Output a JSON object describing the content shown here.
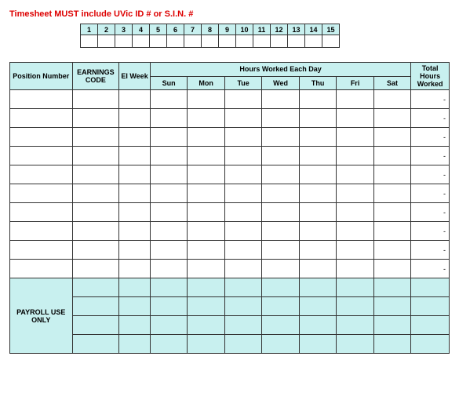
{
  "warning_text": "Timesheet MUST include UVic ID # or S.I.N. #",
  "id_numbers": [
    "1",
    "2",
    "3",
    "4",
    "5",
    "6",
    "7",
    "8",
    "9",
    "10",
    "11",
    "12",
    "13",
    "14",
    "15"
  ],
  "headers": {
    "position": "Position Number",
    "earnings": "EARNINGS CODE",
    "ei_week": "EI Week",
    "hours_group": "Hours Worked Each Day",
    "days": [
      "Sun",
      "Mon",
      "Tue",
      "Wed",
      "Thu",
      "Fri",
      "Sat"
    ],
    "total": "Total Hours Worked"
  },
  "rows": [
    {
      "total": "-"
    },
    {
      "total": "-"
    },
    {
      "total": "-"
    },
    {
      "total": "-"
    },
    {
      "total": "-"
    },
    {
      "total": "-"
    },
    {
      "total": "-"
    },
    {
      "total": "-"
    },
    {
      "total": "-"
    },
    {
      "total": "-"
    }
  ],
  "payroll_label": "PAYROLL USE ONLY",
  "payroll_rows": 4
}
